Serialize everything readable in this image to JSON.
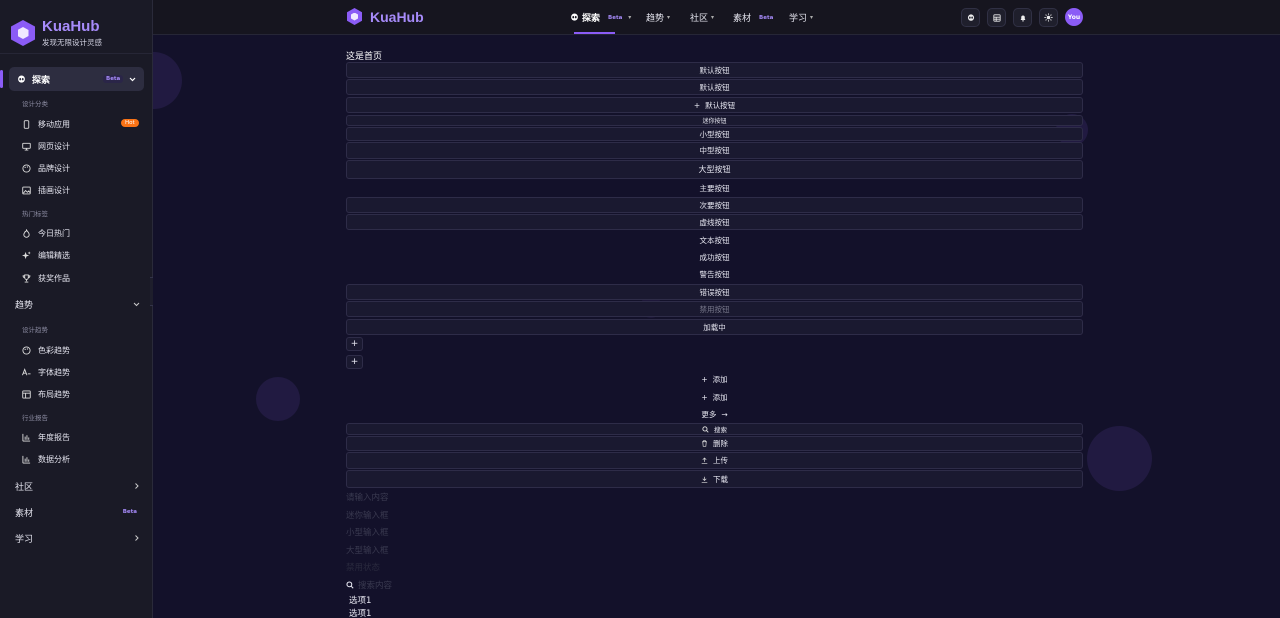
{
  "sidebar": {
    "brand_name": "KuaHub",
    "brand_sub": "发现无限设计灵感",
    "active": {
      "label": "探索",
      "badge": "Beta"
    },
    "explore": {
      "section1": "设计分类",
      "items1": [
        {
          "label": "移动应用",
          "icon": "phone-icon",
          "badge": "Hot"
        },
        {
          "label": "网页设计",
          "icon": "monitor-icon"
        },
        {
          "label": "品牌设计",
          "icon": "palette-icon"
        },
        {
          "label": "插画设计",
          "icon": "image-icon"
        }
      ],
      "section2": "热门标签",
      "items2": [
        {
          "label": "今日热门",
          "icon": "flame-icon"
        },
        {
          "label": "编辑精选",
          "icon": "sparkles-icon"
        },
        {
          "label": "获奖作品",
          "icon": "trophy-icon"
        }
      ]
    },
    "trend": {
      "label": "趋势",
      "section1": "设计趋势",
      "items1": [
        {
          "label": "色彩趋势",
          "icon": "palette-icon"
        },
        {
          "label": "字体趋势",
          "icon": "font-icon"
        },
        {
          "label": "布局趋势",
          "icon": "layout-icon"
        }
      ],
      "section2": "行业报告",
      "items2": [
        {
          "label": "年度报告",
          "icon": "bar-chart-icon"
        },
        {
          "label": "数据分析",
          "icon": "bar-chart-icon"
        }
      ]
    },
    "community": "社区",
    "materials": {
      "label": "素材",
      "badge": "Beta"
    },
    "learn": "学习"
  },
  "topbar": {
    "brand_name": "KuaHub",
    "nav": [
      {
        "label": "探索",
        "badge": "Beta"
      },
      {
        "label": "趋势"
      },
      {
        "label": "社区"
      },
      {
        "label": "素材",
        "badge": "Beta"
      },
      {
        "label": "学习"
      }
    ],
    "avatar": "You"
  },
  "main": {
    "title": "这是首页",
    "buttons": {
      "default1": "默认按钮",
      "default2": "默认按钮",
      "default_icon": "默认按钮",
      "mini": "迷你按钮",
      "small": "小型按钮",
      "medium": "中型按钮",
      "large": "大型按钮",
      "primary": "主要按钮",
      "secondary": "次要按钮",
      "dashed": "虚线按钮",
      "text": "文本按钮",
      "success": "成功按钮",
      "warning": "警告按钮",
      "danger": "错误按钮",
      "disabled": "禁用按钮",
      "loading": "加载中",
      "add1": "添加",
      "add2": "添加",
      "more": "更多",
      "search": "搜索",
      "delete": "删除",
      "upload": "上传",
      "download": "下载"
    },
    "inputs": {
      "placeholder": "请输入内容",
      "mini": "迷你输入框",
      "small": "小型输入框",
      "large": "大型输入框",
      "disabled": "禁用状态",
      "search": "搜索内容"
    },
    "options": [
      "选项1",
      "选项1"
    ]
  },
  "colors": {
    "accent": "#8b5cf6",
    "hot": "#f97316",
    "bg": "#13112a"
  }
}
